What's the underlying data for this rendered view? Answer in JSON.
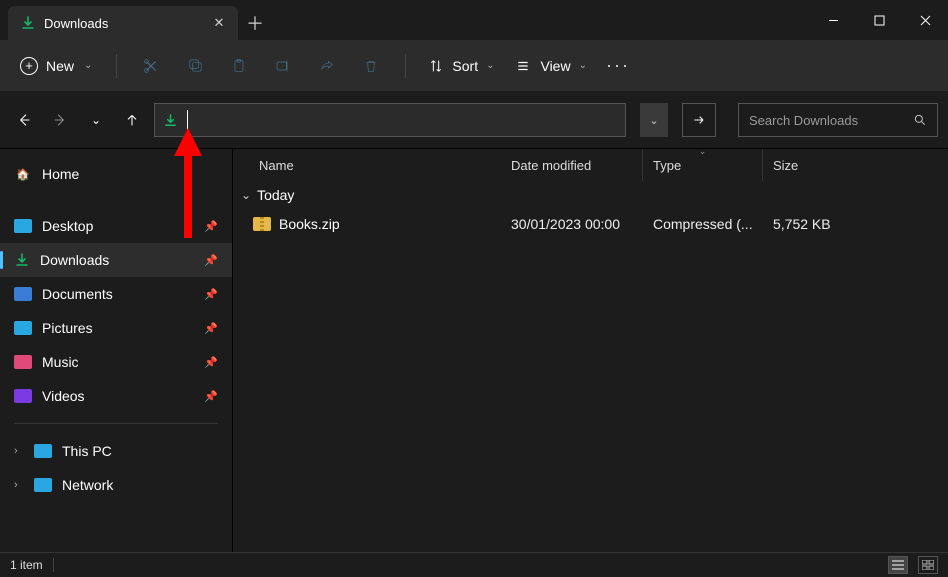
{
  "tab": {
    "title": "Downloads"
  },
  "toolbar": {
    "new_label": "New",
    "sort_label": "Sort",
    "view_label": "View"
  },
  "search": {
    "placeholder": "Search Downloads"
  },
  "sidebar": {
    "home": "Home",
    "items": [
      {
        "label": "Desktop"
      },
      {
        "label": "Downloads"
      },
      {
        "label": "Documents"
      },
      {
        "label": "Pictures"
      },
      {
        "label": "Music"
      },
      {
        "label": "Videos"
      }
    ],
    "thispc": "This PC",
    "network": "Network"
  },
  "columns": {
    "name": "Name",
    "date": "Date modified",
    "type": "Type",
    "size": "Size"
  },
  "group": {
    "label": "Today"
  },
  "files": [
    {
      "name": "Books.zip",
      "date": "30/01/2023 00:00",
      "type": "Compressed (...",
      "size": "5,752 KB"
    }
  ],
  "status": {
    "text": "1 item"
  }
}
